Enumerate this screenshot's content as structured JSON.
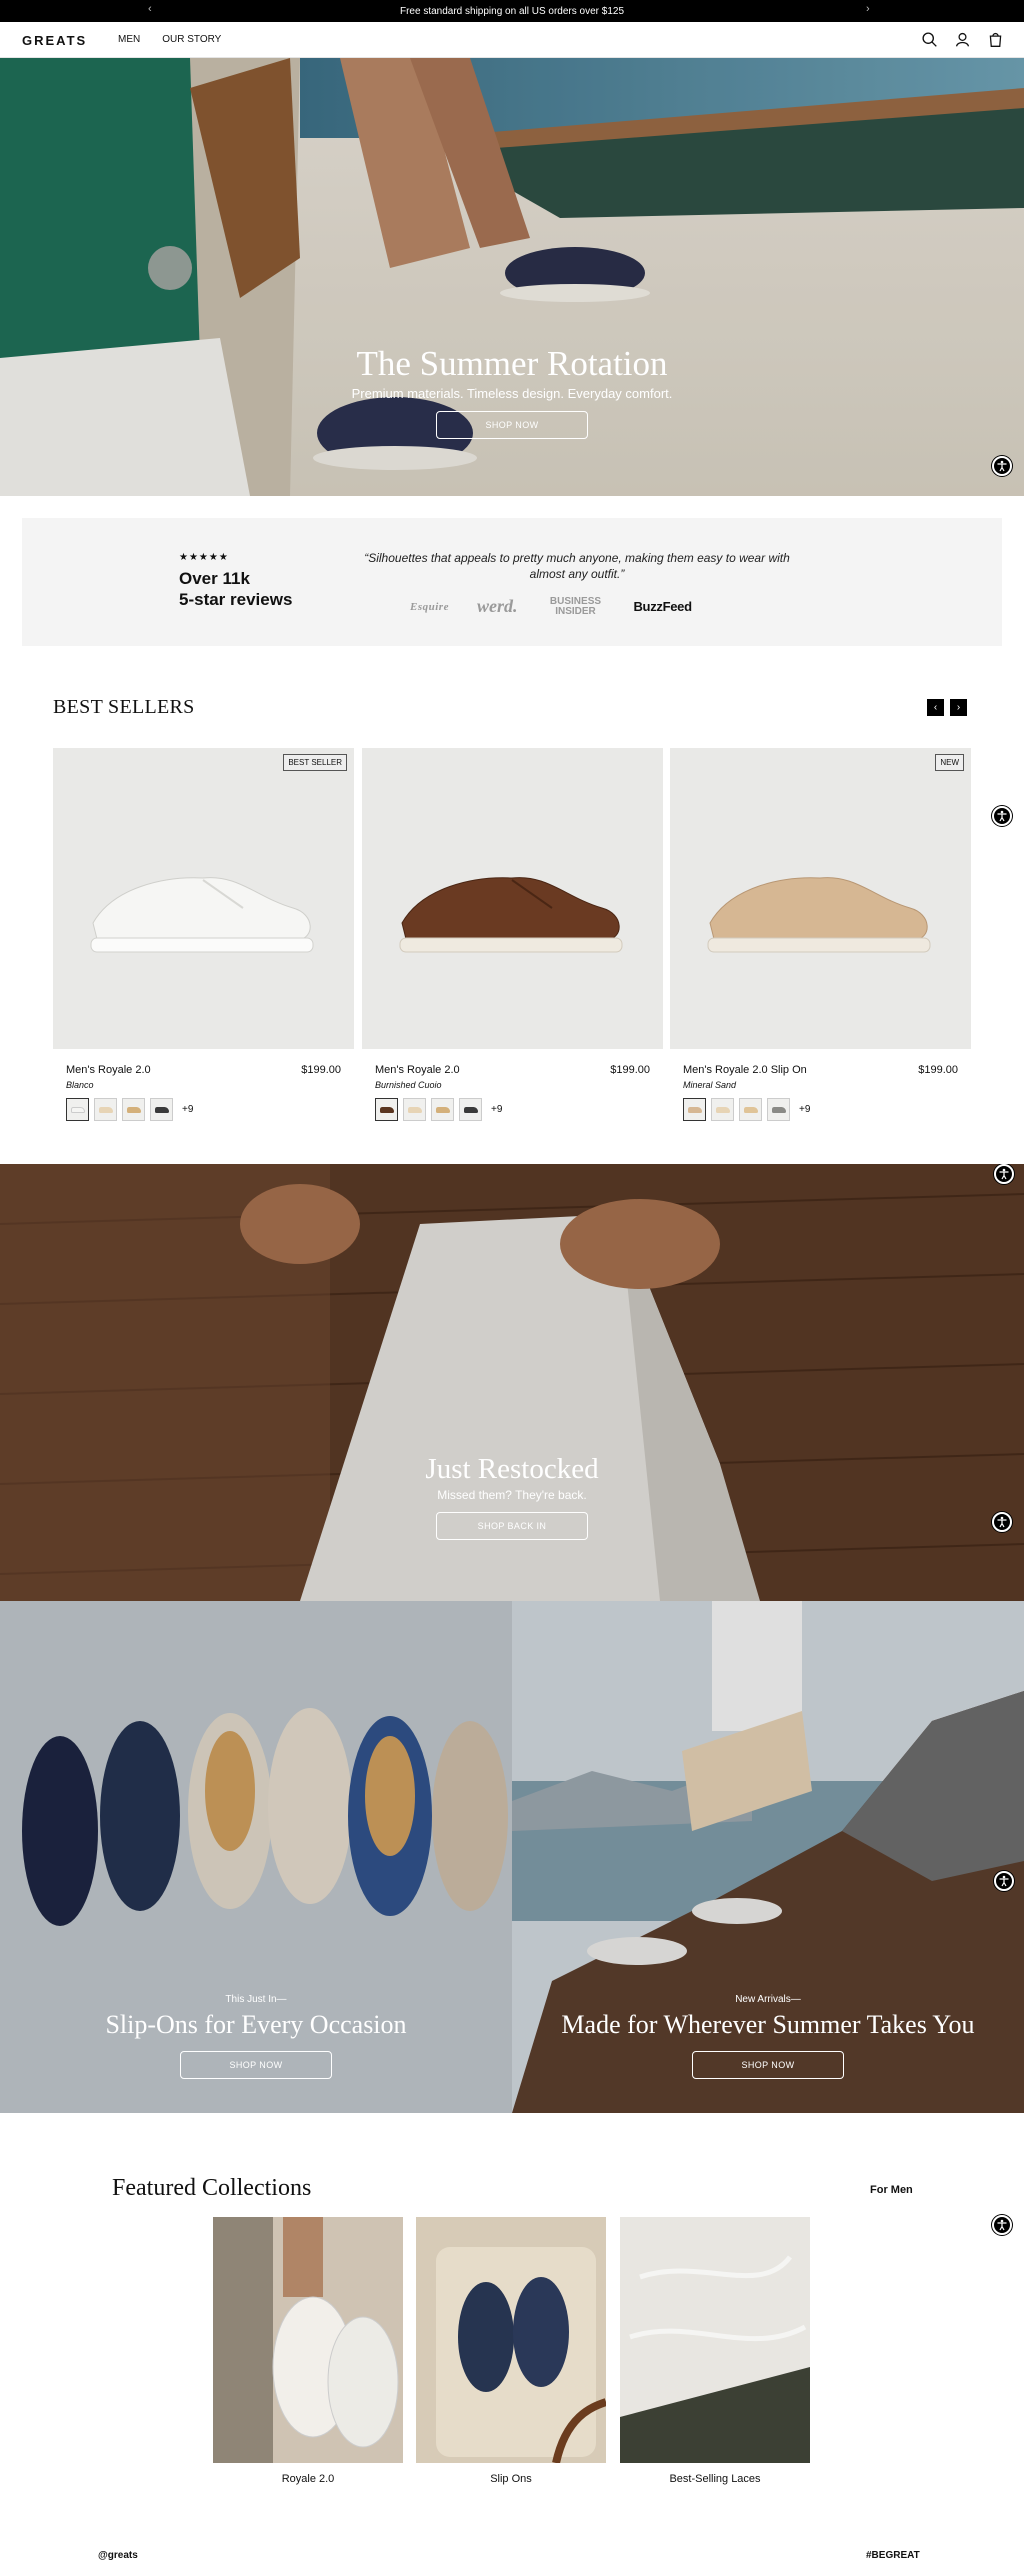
{
  "announcement": {
    "text": "Free standard shipping on all US orders over $125",
    "prev": "‹",
    "next": "›"
  },
  "header": {
    "logo": "GREATS",
    "nav": [
      "MEN",
      "OUR STORY"
    ],
    "icons": [
      "search-icon",
      "account-icon",
      "cart-icon"
    ]
  },
  "hero": {
    "title": "The Summer Rotation",
    "subtitle": "Premium materials. Timeless design. Everyday comfort.",
    "cta": "SHOP NOW"
  },
  "reviews": {
    "stars": "★★★★★",
    "count_line1": "Over 11k",
    "count_line2": "5-star reviews",
    "quote": "“Silhouettes that appeals to pretty much anyone, making them easy to wear with almost any outfit.”",
    "press": [
      "Esquire",
      "werd.",
      "BUSINESS INSIDER",
      "BuzzFeed"
    ]
  },
  "best_sellers": {
    "title": "BEST SELLERS",
    "prev": "‹",
    "next": "›",
    "products": [
      {
        "badge": "BEST SELLER",
        "name": "Men's Royale 2.0",
        "price": "$199.00",
        "color": "Blanco",
        "more": "+9"
      },
      {
        "badge": "",
        "name": "Men's Royale 2.0",
        "price": "$199.00",
        "color": "Burnished Cuoio",
        "more": "+9"
      },
      {
        "badge": "NEW",
        "name": "Men's Royale 2.0 Slip On",
        "price": "$199.00",
        "color": "Mineral Sand",
        "more": "+9"
      }
    ]
  },
  "restocked": {
    "title": "Just Restocked",
    "subtitle": "Missed them? They're back.",
    "cta": "SHOP BACK IN"
  },
  "split": [
    {
      "kicker": "This Just In—",
      "title": "Slip-Ons for Every Occasion",
      "cta": "SHOP NOW"
    },
    {
      "kicker": "New Arrivals—",
      "title": "Made for Wherever Summer Takes You",
      "cta": "SHOP NOW"
    }
  ],
  "featured": {
    "title": "Featured Collections",
    "link": "For Men",
    "items": [
      "Royale 2.0",
      "Slip Ons",
      "Best-Selling Laces"
    ]
  },
  "footer": {
    "handle": "@greats",
    "hashtag": "#BEGREAT"
  },
  "colors": {
    "bar": "#000000",
    "card_bg": "#e9e9e7",
    "review_bg": "#f4f4f4"
  }
}
